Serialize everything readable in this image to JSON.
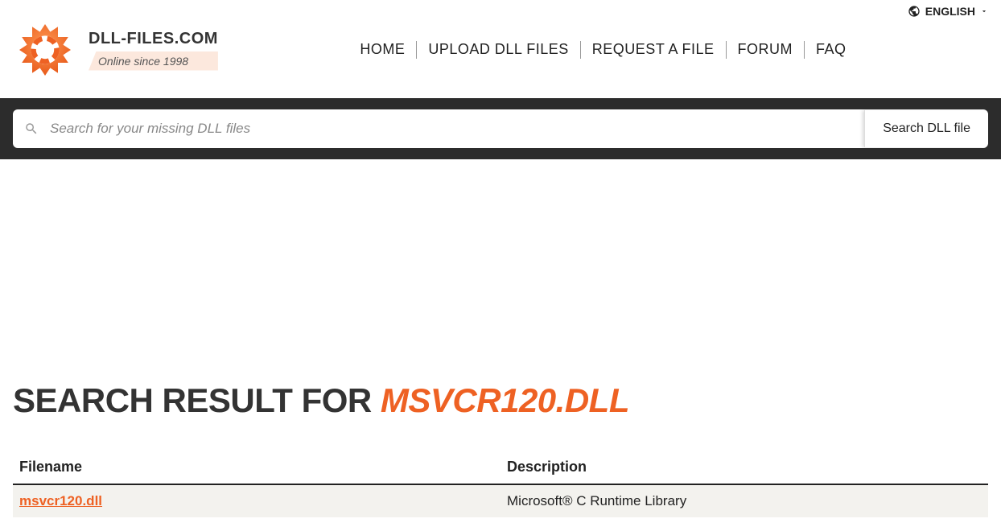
{
  "language": {
    "label": "ENGLISH"
  },
  "brand": {
    "name": "DLL-FILES.COM",
    "tagline": "Online since 1998"
  },
  "nav": {
    "home": "HOME",
    "upload": "UPLOAD DLL FILES",
    "request": "REQUEST A FILE",
    "forum": "FORUM",
    "faq": "FAQ"
  },
  "search": {
    "placeholder": "Search for your missing DLL files",
    "button": "Search DLL file"
  },
  "results": {
    "heading_prefix": "SEARCH RESULT FOR ",
    "query": "MSVCR120.DLL",
    "columns": {
      "filename": "Filename",
      "description": "Description"
    },
    "rows": [
      {
        "filename": "msvcr120.dll",
        "description": "Microsoft® C Runtime Library"
      }
    ]
  }
}
